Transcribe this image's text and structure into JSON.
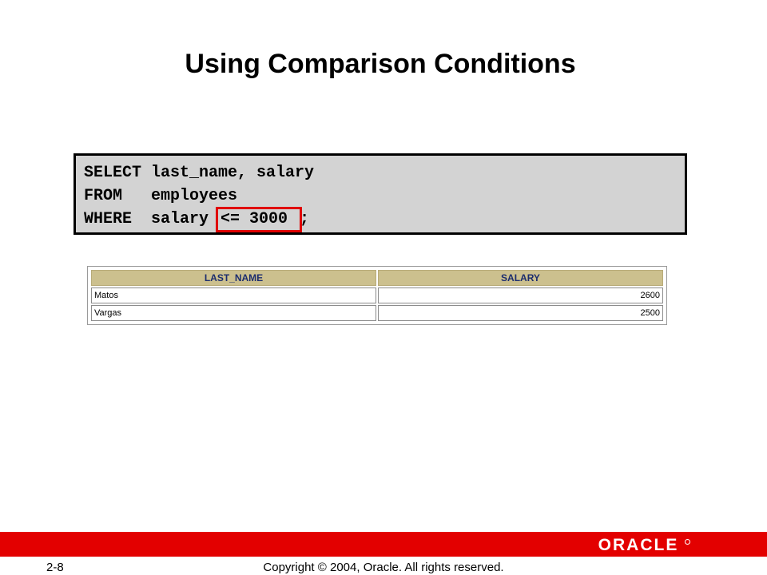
{
  "slide": {
    "title": "Using Comparison Conditions"
  },
  "code": {
    "line1": "SELECT last_name, salary",
    "line2": "FROM   employees",
    "line3_prefix": "WHERE  salary ",
    "line3_highlight": "<= 3000 ",
    "line3_suffix": ";",
    "highlight_color": "#e00000"
  },
  "result": {
    "columns": [
      "LAST_NAME",
      "SALARY"
    ],
    "rows": [
      [
        "Matos",
        "2600"
      ],
      [
        "Vargas",
        "2500"
      ]
    ],
    "header_bg": "#ccc08e",
    "header_text_color": "#1c2d6e"
  },
  "footer": {
    "page_number": "2-8",
    "copyright": "Copyright © 2004, Oracle.  All rights reserved.",
    "logo_text": "ORACLE",
    "bar_color": "#e30000"
  }
}
